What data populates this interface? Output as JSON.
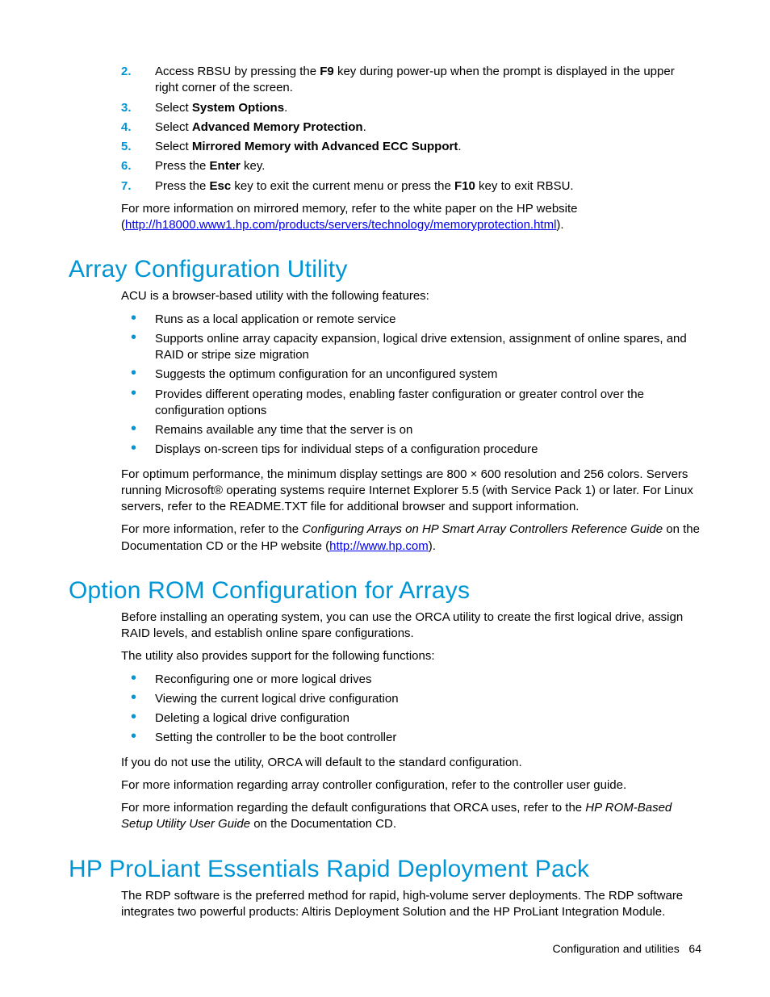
{
  "steps": [
    {
      "num": "2.",
      "pre": "Access RBSU by pressing the ",
      "b1": "F9",
      "post": " key during power-up when the prompt is displayed in the upper right corner of the screen."
    },
    {
      "num": "3.",
      "pre": "Select ",
      "b1": "System Options",
      "post": "."
    },
    {
      "num": "4.",
      "pre": "Select ",
      "b1": "Advanced Memory Protection",
      "post": "."
    },
    {
      "num": "5.",
      "pre": "Select ",
      "b1": "Mirrored Memory with Advanced ECC Support",
      "post": "."
    },
    {
      "num": "6.",
      "pre": "Press the ",
      "b1": "Enter",
      "post": " key."
    },
    {
      "num": "7.",
      "pre": "Press the ",
      "b1": "Esc",
      "mid": " key to exit the current menu or press the ",
      "b2": "F10",
      "post": " key to exit RBSU."
    }
  ],
  "mirror_info_pre": "For more information on mirrored memory, refer to the white paper on the HP website (",
  "mirror_link": "http://h18000.www1.hp.com/products/servers/technology/memoryprotection.html",
  "mirror_info_post": ").",
  "acu": {
    "heading": "Array Configuration Utility",
    "intro": "ACU is a browser-based utility with the following features:",
    "bullets": [
      "Runs as a local application or remote service",
      "Supports online array capacity expansion, logical drive extension, assignment of online spares, and RAID or stripe size migration",
      "Suggests the optimum configuration for an unconfigured system",
      "Provides different operating modes, enabling faster configuration or greater control over the configuration options",
      "Remains available any time that the server is on",
      "Displays on-screen tips for individual steps of a configuration procedure"
    ],
    "perf": "For optimum performance, the minimum display settings are 800 × 600 resolution and 256 colors. Servers running Microsoft® operating systems require Internet Explorer 5.5 (with Service Pack 1) or later. For Linux servers, refer to the README.TXT file for additional browser and support information.",
    "more_pre": "For more information, refer to the ",
    "more_title": "Configuring Arrays on HP Smart Array Controllers Reference Guide",
    "more_mid": " on the Documentation CD or the HP website (",
    "more_link": "http://www.hp.com",
    "more_post": ")."
  },
  "orca": {
    "heading": "Option ROM Configuration for Arrays",
    "intro": "Before installing an operating system, you can use the ORCA utility to create the first logical drive, assign RAID levels, and establish online spare configurations.",
    "support": "The utility also provides support for the following functions:",
    "bullets": [
      "Reconfiguring one or more logical drives",
      "Viewing the current logical drive configuration",
      "Deleting a logical drive configuration",
      "Setting the controller to be the boot controller"
    ],
    "default": "If you do not use the utility, ORCA will default to the standard configuration.",
    "controller": "For more information regarding array controller configuration, refer to the controller user guide.",
    "rom_pre": "For more information regarding the default configurations that ORCA uses, refer to the ",
    "rom_title": "HP ROM-Based Setup Utility User Guide",
    "rom_post": " on the Documentation CD."
  },
  "rdp": {
    "heading": "HP ProLiant Essentials Rapid Deployment Pack",
    "body": "The RDP software is the preferred method for rapid, high-volume server deployments. The RDP software integrates two powerful products: Altiris Deployment Solution and the HP ProLiant Integration Module."
  },
  "footer": {
    "section": "Configuration and utilities",
    "page": "64"
  }
}
